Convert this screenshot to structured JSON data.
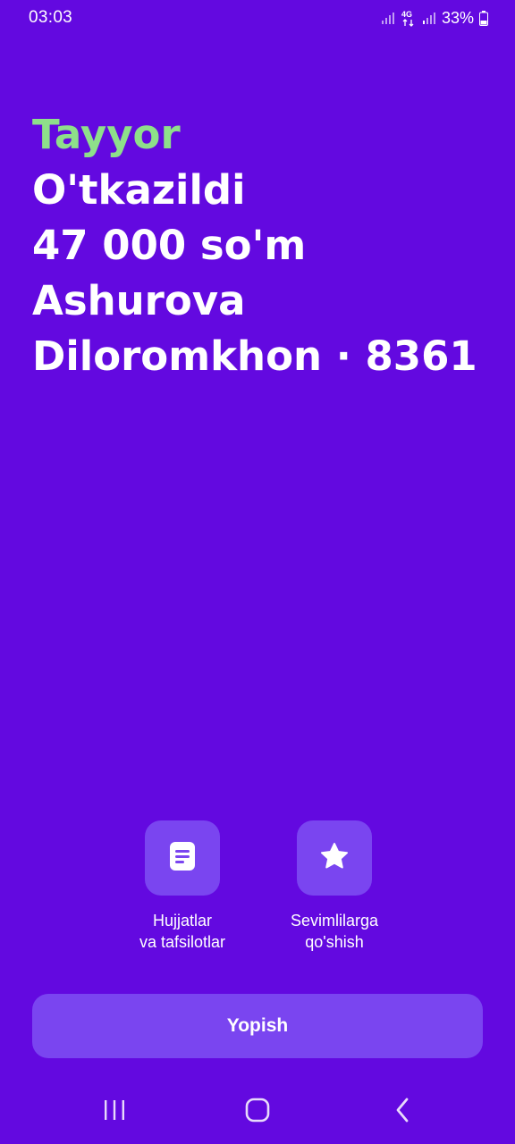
{
  "status_bar": {
    "time": "03:03",
    "network": "4G",
    "battery": "33%",
    "icons": [
      "signal-icon",
      "network-4g-icon",
      "signal-icon",
      "battery-icon"
    ]
  },
  "result": {
    "status": "Tayyor",
    "title": "O'tkazildi",
    "amount": "47 000 so'm",
    "recipient_last": "Ashurova",
    "recipient_first_card": "Diloromkhon · 8361"
  },
  "actions": [
    {
      "icon": "document-icon",
      "label_line1": "Hujjatlar",
      "label_line2": "va tafsilotlar"
    },
    {
      "icon": "star-icon",
      "label_line1": "Sevimlilarga",
      "label_line2": "qo'shish"
    }
  ],
  "close_button": {
    "label": "Yopish"
  },
  "nav": {
    "icons": [
      "recents-icon",
      "home-icon",
      "back-icon"
    ]
  },
  "colors": {
    "background": "#6309E0",
    "status_green": "#8EE08A",
    "tile": "#7A45F0",
    "text": "#FFFFFF"
  }
}
